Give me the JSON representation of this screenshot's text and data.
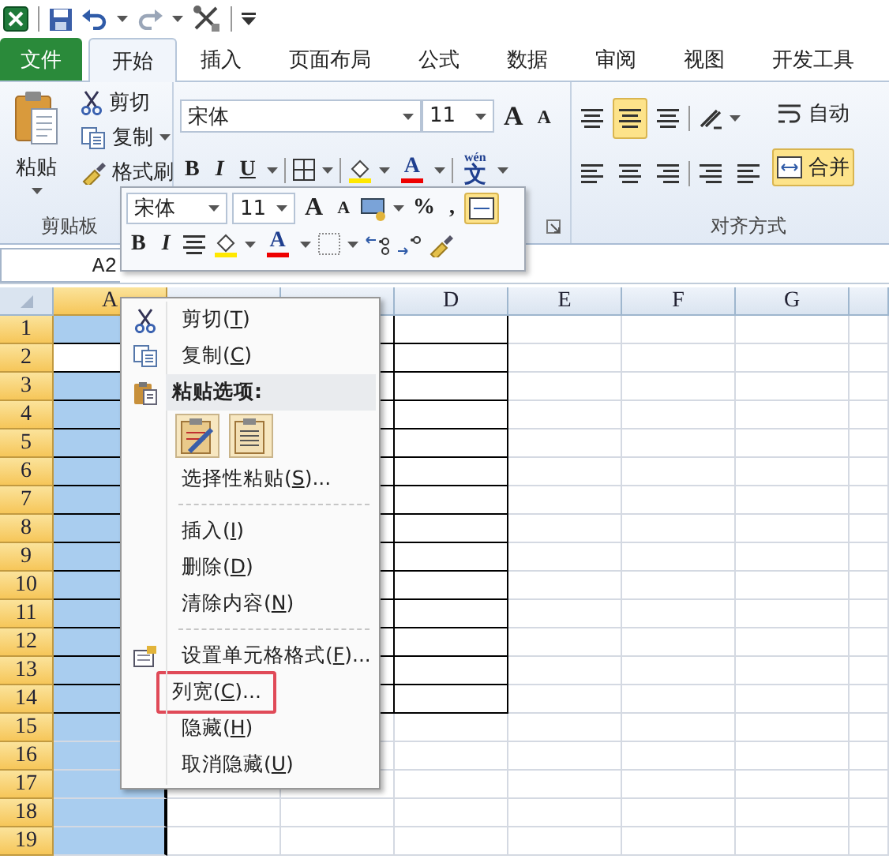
{
  "tabs": [
    {
      "label": "文件",
      "kind": "file",
      "selected": false
    },
    {
      "label": "开始",
      "kind": "tab",
      "selected": true
    },
    {
      "label": "插入",
      "kind": "tab",
      "selected": false
    },
    {
      "label": "页面布局",
      "kind": "tab",
      "selected": false
    },
    {
      "label": "公式",
      "kind": "tab",
      "selected": false
    },
    {
      "label": "数据",
      "kind": "tab",
      "selected": false
    },
    {
      "label": "审阅",
      "kind": "tab",
      "selected": false
    },
    {
      "label": "视图",
      "kind": "tab",
      "selected": false
    },
    {
      "label": "开发工具",
      "kind": "tab",
      "selected": false
    }
  ],
  "ribbon": {
    "clipboard": {
      "paste": "粘贴",
      "cut": "剪切",
      "copy": "复制",
      "format_painter": "格式刷",
      "label": "剪贴板"
    },
    "font": {
      "face": "宋体",
      "size": "11",
      "grow": "A",
      "shrink": "A",
      "bold": "B",
      "italic": "I",
      "underline": "U",
      "font_color": "A",
      "phonetic": "wén",
      "phonetic_char": "文"
    },
    "alignment": {
      "middle_selected": true,
      "wrap": "自动",
      "merge": "合并",
      "merge_selected": true,
      "label": "对齐方式"
    }
  },
  "name_box": "A2",
  "mini_toolbar": {
    "face": "宋体",
    "size": "11",
    "grow": "A",
    "shrink": "A",
    "percent": "%",
    "comma": ",",
    "merge_selected": true,
    "bold": "B",
    "italic": "I",
    "font_color": "A"
  },
  "context_menu": {
    "items": [
      {
        "kind": "command",
        "before": "剪切(",
        "key": "T",
        "after": ")",
        "highlighted": false
      },
      {
        "kind": "command",
        "before": "复制(",
        "key": "C",
        "after": ")",
        "highlighted": false
      },
      {
        "kind": "header",
        "text": "粘贴选项:"
      },
      {
        "kind": "paste_options"
      },
      {
        "kind": "command",
        "before": "选择性粘贴(",
        "key": "S",
        "after": ")...",
        "highlighted": false
      },
      {
        "kind": "separator"
      },
      {
        "kind": "command",
        "before": "插入(",
        "key": "I",
        "after": ")",
        "highlighted": false
      },
      {
        "kind": "command",
        "before": "删除(",
        "key": "D",
        "after": ")",
        "highlighted": false
      },
      {
        "kind": "command",
        "before": "清除内容(",
        "key": "N",
        "after": ")",
        "highlighted": false
      },
      {
        "kind": "separator"
      },
      {
        "kind": "command",
        "before": "设置单元格格式(",
        "key": "F",
        "after": ")...",
        "highlighted": false
      },
      {
        "kind": "command",
        "before": "列宽(",
        "key": "C",
        "after": ")...",
        "highlighted": true
      },
      {
        "kind": "command",
        "before": "隐藏(",
        "key": "H",
        "after": ")",
        "highlighted": false
      },
      {
        "kind": "command",
        "before": "取消隐藏(",
        "key": "U",
        "after": ")",
        "highlighted": false
      }
    ]
  },
  "sheet": {
    "columns": [
      {
        "label": "A",
        "selected": true,
        "bordered": true
      },
      {
        "selected": false
      },
      {
        "selected": false,
        "bordered": true
      },
      {
        "label": "D",
        "selected": false,
        "bordered": true
      },
      {
        "label": "E",
        "selected": false,
        "bordered": false
      },
      {
        "label": "F",
        "selected": false,
        "bordered": false
      },
      {
        "label": "G",
        "selected": false,
        "bordered": false
      },
      {
        "selected": false
      }
    ],
    "rows": [
      {
        "label": "1",
        "selected": true,
        "bordered": true,
        "active": false
      },
      {
        "label": "2",
        "selected": true,
        "bordered": true,
        "active": true
      },
      {
        "label": "3",
        "selected": true,
        "bordered": true,
        "active": false
      },
      {
        "label": "4",
        "selected": true,
        "bordered": true,
        "active": false
      },
      {
        "label": "5",
        "selected": true,
        "bordered": true,
        "active": false
      },
      {
        "label": "6",
        "selected": true,
        "bordered": true,
        "active": false
      },
      {
        "label": "7",
        "selected": true,
        "bordered": true,
        "active": false
      },
      {
        "label": "8",
        "selected": true,
        "bordered": true,
        "active": false
      },
      {
        "label": "9",
        "selected": true,
        "bordered": true,
        "active": false
      },
      {
        "label": "10",
        "selected": true,
        "bordered": true,
        "active": false
      },
      {
        "label": "11",
        "selected": true,
        "bordered": true,
        "active": false
      },
      {
        "label": "12",
        "selected": true,
        "bordered": true,
        "active": false
      },
      {
        "label": "13",
        "selected": true,
        "bordered": true,
        "active": false
      },
      {
        "label": "14",
        "selected": true,
        "bordered": true,
        "active": false
      },
      {
        "label": "15",
        "selected": true,
        "bordered": false,
        "active": false
      },
      {
        "label": "16",
        "selected": true,
        "bordered": false,
        "active": false
      },
      {
        "label": "17",
        "selected": true,
        "bordered": false,
        "active": false
      },
      {
        "label": "18",
        "selected": true,
        "bordered": false,
        "active": false
      },
      {
        "label": "19",
        "selected": true,
        "bordered": false,
        "active": false
      }
    ]
  }
}
